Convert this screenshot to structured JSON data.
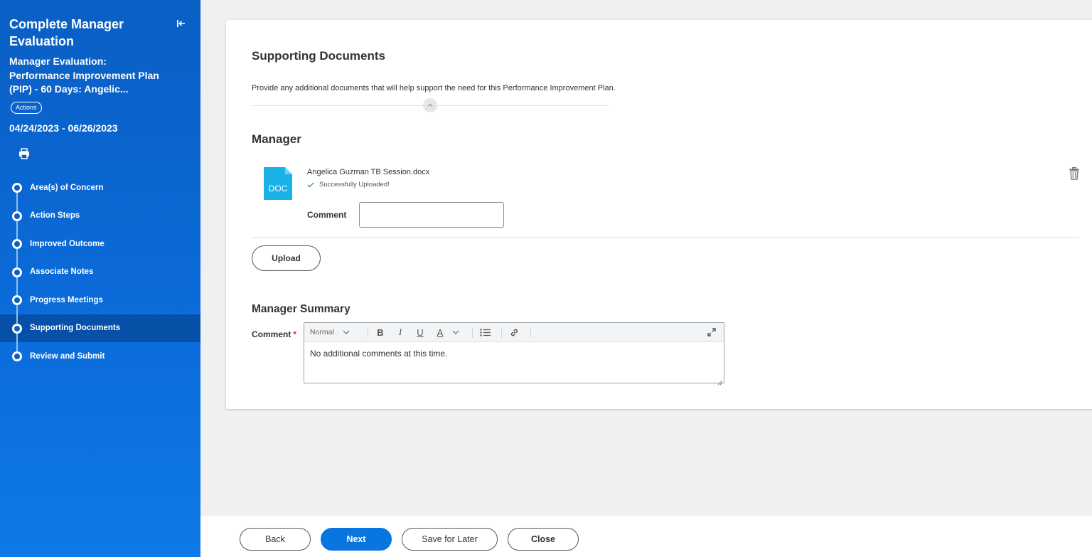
{
  "sidebar": {
    "title": "Complete Manager Evaluation",
    "subtitle": "Manager Evaluation: Performance Improvement Plan (PIP) - 60 Days: Angelic...",
    "actions_label": "Actions",
    "date_range": "04/24/2023 - 06/26/2023",
    "steps": [
      {
        "label": "Area(s) of Concern"
      },
      {
        "label": "Action Steps"
      },
      {
        "label": "Improved Outcome"
      },
      {
        "label": "Associate Notes"
      },
      {
        "label": "Progress Meetings"
      },
      {
        "label": "Supporting Documents",
        "active": true
      },
      {
        "label": "Review and Submit"
      }
    ]
  },
  "main": {
    "section_title": "Supporting Documents",
    "description": "Provide any additional documents that will help support the need for this Performance Improvement Plan.",
    "manager_heading": "Manager",
    "attachment": {
      "icon_text": "DOC",
      "file_name": "Angelica Guzman TB Session.docx",
      "status": "Successfully Uploaded!",
      "comment_label": "Comment",
      "comment_value": ""
    },
    "upload_label": "Upload",
    "summary_heading": "Manager Summary",
    "summary_comment_label": "Comment",
    "required_marker": "*",
    "editor": {
      "format_value": "Normal",
      "bold": "B",
      "italic": "I",
      "underline": "U",
      "font_color": "A",
      "text": "No additional comments at this time."
    }
  },
  "footer": {
    "back": "Back",
    "next": "Next",
    "save_for_later": "Save for Later",
    "close": "Close"
  },
  "colors": {
    "sidebar_blue": "#0a5fc4",
    "active_step": "#0650a8",
    "primary_button": "#0875e1",
    "doc_icon": "#1ab0e8",
    "success_check": "#43a047",
    "required": "#de2e21"
  }
}
